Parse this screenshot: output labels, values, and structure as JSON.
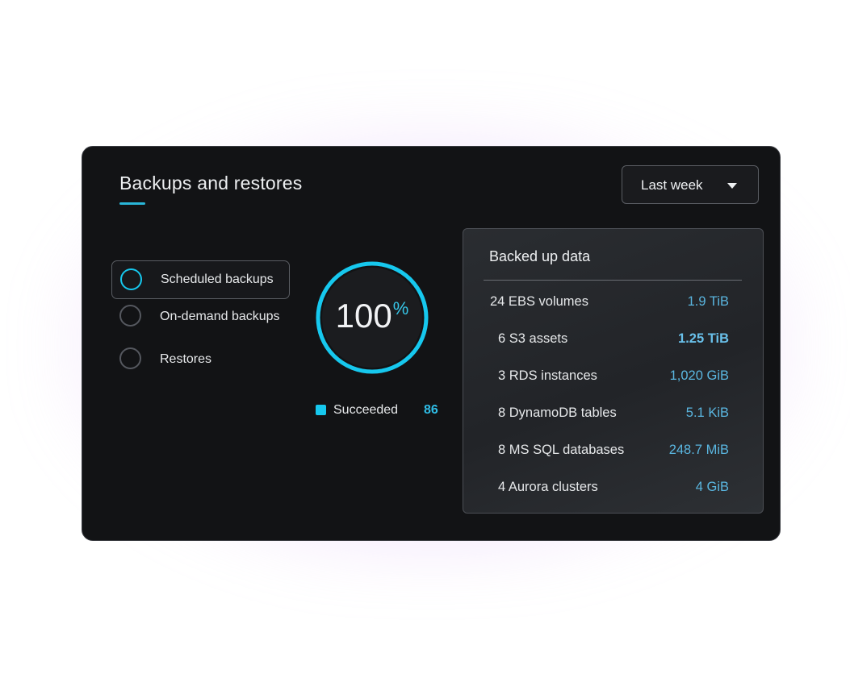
{
  "card": {
    "title": "Backups and restores",
    "period_selector": {
      "value": "Last week"
    }
  },
  "options": [
    {
      "label": "Scheduled backups",
      "selected": true
    },
    {
      "label": "On-demand backups",
      "selected": false
    },
    {
      "label": "Restores",
      "selected": false
    }
  ],
  "gauge": {
    "value": "100",
    "unit": "%",
    "fill_fraction": 1.0,
    "legend_label": "Succeeded",
    "legend_count": "86"
  },
  "backed_up": {
    "title": "Backed up data",
    "rows": [
      {
        "label": "24 EBS volumes",
        "value": "1.9 TiB"
      },
      {
        "label": "6 S3 assets",
        "value": "1.25 TiB"
      },
      {
        "label": "3 RDS instances",
        "value": "1,020 GiB"
      },
      {
        "label": "8 DynamoDB tables",
        "value": "5.1 KiB"
      },
      {
        "label": "8 MS SQL databases",
        "value": "248.7 MiB"
      },
      {
        "label": "4 Aurora clusters",
        "value": "4 GiB"
      }
    ]
  },
  "colors": {
    "accent": "#16c8ee",
    "value_text": "#5ab6e0",
    "card_bg": "#121315"
  }
}
